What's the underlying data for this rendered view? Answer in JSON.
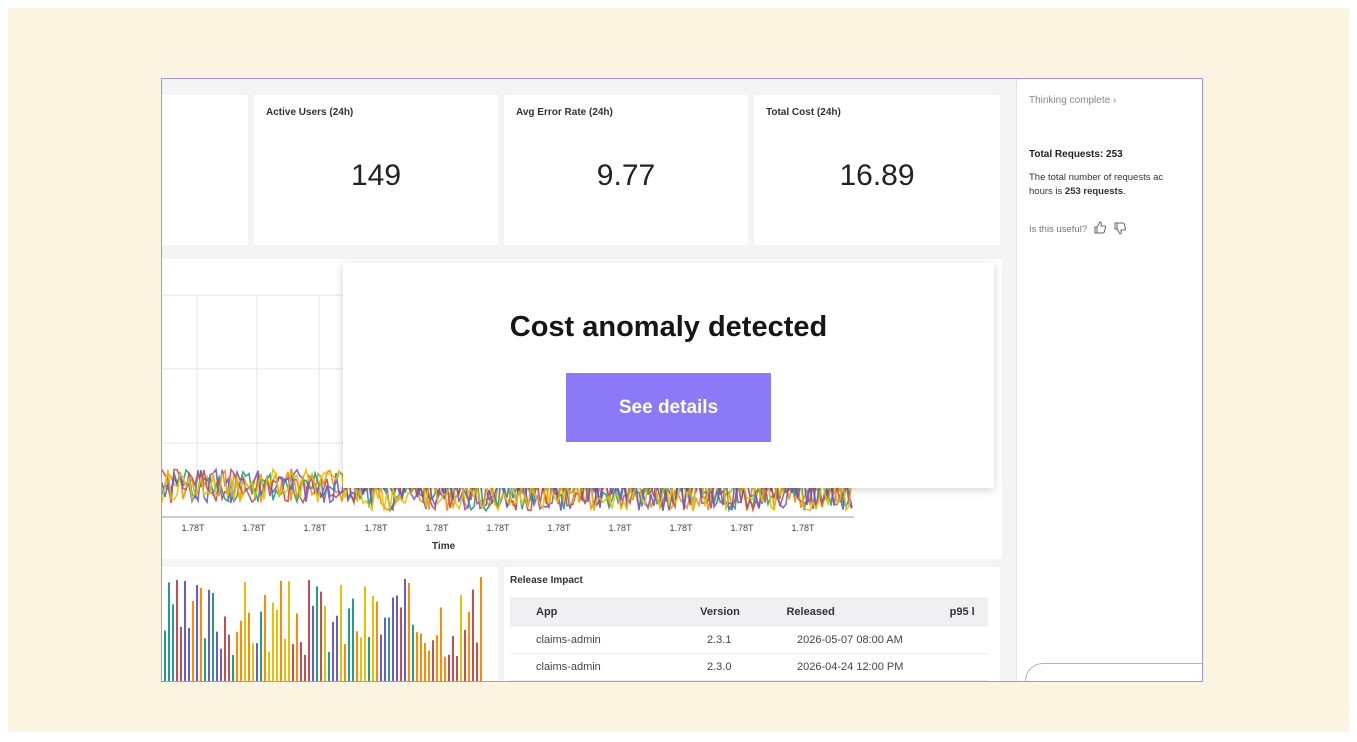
{
  "kpis": [
    {
      "title": "Active Users (24h)",
      "value": "149"
    },
    {
      "title": "Avg Error Rate (24h)",
      "value": "9.77"
    },
    {
      "title": "Total Cost (24h)",
      "value": "16.89"
    }
  ],
  "timeseries": {
    "x_tick_label": "1.78T",
    "x_tick_count": 11,
    "xlabel": "Time",
    "series_colors": [
      "#ff8c00",
      "#1f9e89",
      "#c44e52",
      "#6a5acd",
      "#e5c100"
    ]
  },
  "release_impact": {
    "title": "Release Impact",
    "columns": [
      "App",
      "Version",
      "Released",
      "p95 l"
    ],
    "rows": [
      {
        "app": "claims-admin",
        "version": "2.3.1",
        "released": "2026-05-07 08:00 AM"
      },
      {
        "app": "claims-admin",
        "version": "2.3.0",
        "released": "2026-04-24 12:00 PM"
      }
    ]
  },
  "sidebar": {
    "thinking": "Thinking complete",
    "answer_title": "Total Requests: 253",
    "answer_text_prefix": "The total number of requests ac",
    "answer_text_line2_prefix": "hours is ",
    "answer_text_bold": "253 requests",
    "answer_text_suffix": ".",
    "useful_prompt": "Is this useful?"
  },
  "modal": {
    "title": "Cost anomaly detected",
    "button_label": "See details"
  },
  "colors": {
    "accent": "#8c79f7",
    "frame_border": "#a094f2",
    "backdrop": "#fbf4e1"
  }
}
